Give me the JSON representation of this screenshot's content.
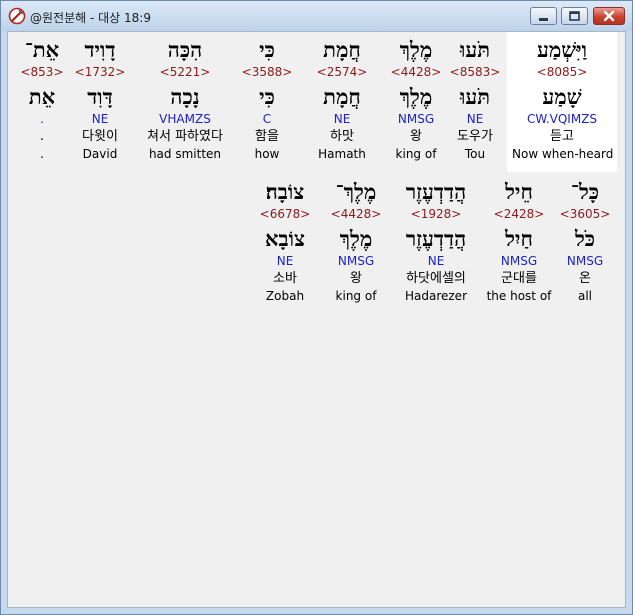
{
  "window": {
    "title": "@원전분해 - 대상 18:9"
  },
  "rows": [
    {
      "words": [
        {
          "heb": "וַיִּשְׁמַע",
          "strong": "<8085>",
          "root": "שָׁמַע",
          "morph": "CW.VQIMZS",
          "kor": "듣고",
          "eng": "Now when-heard"
        },
        {
          "heb": "תֹּעוּ",
          "strong": "<8583>",
          "root": "תֹּעוּ",
          "morph": "NE",
          "kor": "도우가",
          "eng": "Tou"
        },
        {
          "heb": "מֶלֶךְ",
          "strong": "<4428>",
          "root": "מֶלֶךְ",
          "morph": "NMSG",
          "kor": "왕",
          "eng": "king of"
        },
        {
          "heb": "חֲמָת",
          "strong": "<2574>",
          "root": "חֲמָת",
          "morph": "NE",
          "kor": "하맛",
          "eng": "Hamath"
        },
        {
          "heb": "כִּי",
          "strong": "<3588>",
          "root": "כִּי",
          "morph": "C",
          "kor": "함을",
          "eng": "how"
        },
        {
          "heb": "הִכָּה",
          "strong": "<5221>",
          "root": "נָכָה",
          "morph": "VHAMZS",
          "kor": "쳐서 파하였다",
          "eng": "had smitten"
        },
        {
          "heb": "דָוִיד",
          "strong": "<1732>",
          "root": "דָּוִד",
          "morph": "NE",
          "kor": "다윗이",
          "eng": "David"
        },
        {
          "heb": "אֵת־",
          "strong": "<853>",
          "root": "אֵת",
          "morph": ".",
          "kor": ".",
          "eng": "."
        }
      ]
    },
    {
      "words": [
        {
          "heb": "כָּל־",
          "strong": "<3605>",
          "root": "כֹּל",
          "morph": "NMSG",
          "kor": "온",
          "eng": "all"
        },
        {
          "heb": "חֵיל",
          "strong": "<2428>",
          "root": "חַיִל",
          "morph": "NMSG",
          "kor": "군대를",
          "eng": "the host of"
        },
        {
          "heb": "הֲדַדְעֶזֶר",
          "strong": "<1928>",
          "root": "הֲדַדְעֶזֶר",
          "morph": "NE",
          "kor": "하닷에셀의",
          "eng": "Hadarezer"
        },
        {
          "heb": "מֶלֶךְ־",
          "strong": "<4428>",
          "root": "מֶלֶךְ",
          "morph": "NMSG",
          "kor": "왕",
          "eng": "king of"
        },
        {
          "heb": "צוֹבָה׃",
          "strong": "<6678>",
          "root": "צוֹבָא",
          "morph": "NE",
          "kor": "소바",
          "eng": "Zobah"
        }
      ]
    }
  ]
}
